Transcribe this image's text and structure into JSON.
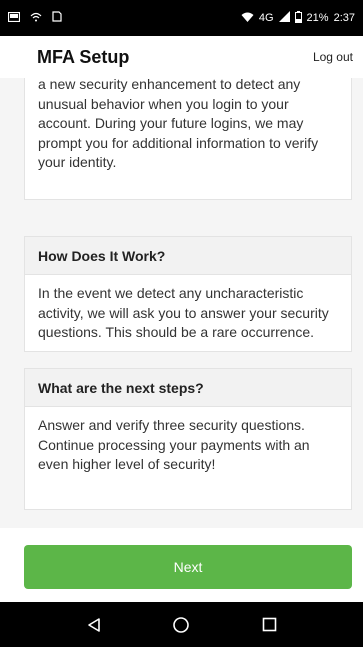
{
  "status_bar": {
    "network": "4G",
    "battery": "21%",
    "time": "2:37"
  },
  "header": {
    "title": "MFA Setup",
    "logout_label": "Log out"
  },
  "cards": [
    {
      "heading": "",
      "body": "a new security enhancement to detect any unusual behavior when you login to your account. During your future logins, we may prompt you for additional information to verify your identity."
    },
    {
      "heading": "How Does It Work?",
      "body": "In the event we detect any uncharacteristic activity, we will ask you to answer your security questions. This should be a rare occurrence."
    },
    {
      "heading": "What are the next steps?",
      "body": "Answer and verify three security questions. Continue processing your payments with an even higher level of security!"
    }
  ],
  "footer": {
    "next_label": "Next"
  },
  "nav": {
    "icons": [
      "back-icon",
      "home-icon",
      "recents-icon"
    ]
  },
  "colors": {
    "accent": "#5cb648",
    "status_bar": "#000000",
    "card_header": "#f2f2f2"
  }
}
